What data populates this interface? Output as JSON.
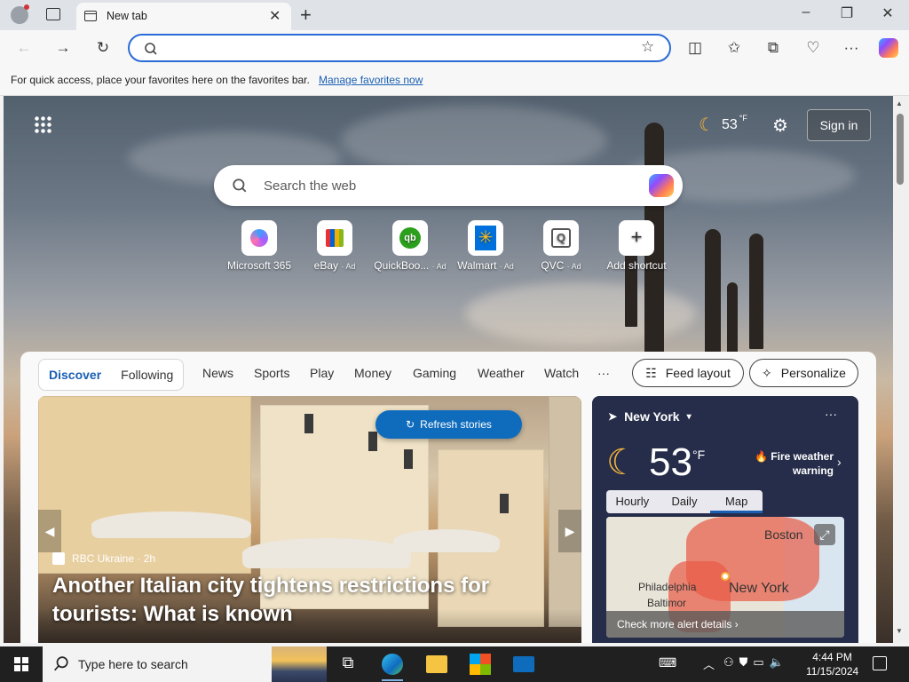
{
  "tab": {
    "title": "New tab"
  },
  "favbar": {
    "message": "For quick access, place your favorites here on the favorites bar.",
    "link": "Manage favorites now"
  },
  "header": {
    "weather_temp": "53",
    "weather_unit": "°F",
    "sign_in": "Sign in"
  },
  "search": {
    "placeholder": "Search the web"
  },
  "tiles": [
    {
      "label": "Microsoft 365",
      "ad": ""
    },
    {
      "label": "eBay",
      "ad": "· Ad"
    },
    {
      "label": "QuickBoo...",
      "ad": "· Ad"
    },
    {
      "label": "Walmart",
      "ad": "· Ad"
    },
    {
      "label": "QVC",
      "ad": "· Ad"
    },
    {
      "label": "Add shortcut",
      "ad": ""
    }
  ],
  "feed": {
    "pills": [
      "Discover",
      "Following"
    ],
    "nav": [
      "News",
      "Sports",
      "Play",
      "Money",
      "Gaming",
      "Weather",
      "Watch"
    ],
    "more": "···",
    "feed_layout": "Feed layout",
    "personalize": "Personalize"
  },
  "story": {
    "refresh": "Refresh stories",
    "source": "RBC Ukraine",
    "age": "· 2h",
    "headline": "Another Italian city tightens restrictions for tourists: What is known"
  },
  "weather": {
    "location": "New York",
    "temp": "53",
    "unit": "°F",
    "alert": "Fire weather warning",
    "tabs": [
      "Hourly",
      "Daily",
      "Map"
    ],
    "map_labels": [
      "Boston",
      "Philadelphia",
      "Baltimor",
      "New York"
    ],
    "alert_link": "Check more alert details"
  },
  "taskbar": {
    "search_placeholder": "Type here to search",
    "time": "4:44 PM",
    "date": "11/15/2024"
  },
  "colors": {
    "accent": "#0f6cbd",
    "weather_bg": "#262d4a",
    "alert": "#e85a46"
  }
}
